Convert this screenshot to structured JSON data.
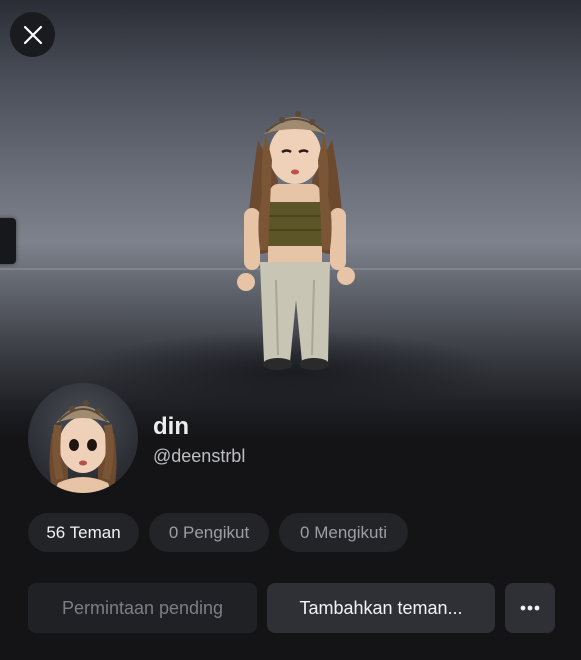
{
  "profile": {
    "display_name": "din",
    "username": "@deenstrbl"
  },
  "stats": {
    "friends_label": "56 Teman",
    "followers_label": "0 Pengikut",
    "following_label": "0 Mengikuti"
  },
  "actions": {
    "pending_label": "Permintaan pending",
    "add_friend_label": "Tambahkan teman...",
    "more_icon": "more-horizontal-icon"
  },
  "icons": {
    "close": "close-icon"
  },
  "colors": {
    "background": "#141417",
    "chip_bg": "#232428",
    "button_bg": "#2f3035",
    "disabled_text": "#7d7e84"
  }
}
